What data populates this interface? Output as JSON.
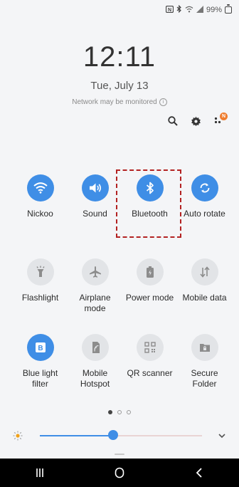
{
  "status_bar": {
    "nfc_icon": "nfc-icon",
    "bluetooth_icon": "bluetooth-icon",
    "wifi_icon": "wifi-icon",
    "signal_icon": "signal-icon",
    "battery_text": "99%"
  },
  "lock": {
    "time": "12:11",
    "date": "Tue, July 13",
    "network_notice": "Network may be monitored"
  },
  "actions": {
    "search_icon": "search-icon",
    "settings_icon": "gear-icon",
    "notification_badge": "N"
  },
  "tiles": [
    {
      "label": "Nickoo",
      "icon": "wifi-icon",
      "state": "on"
    },
    {
      "label": "Sound",
      "icon": "speaker-icon",
      "state": "on"
    },
    {
      "label": "Bluetooth",
      "icon": "bluetooth-icon",
      "state": "on"
    },
    {
      "label": "Auto rotate",
      "icon": "rotate-icon",
      "state": "on"
    },
    {
      "label": "Flashlight",
      "icon": "flashlight-icon",
      "state": "off"
    },
    {
      "label": "Airplane mode",
      "icon": "airplane-icon",
      "state": "off"
    },
    {
      "label": "Power mode",
      "icon": "battery-icon",
      "state": "off"
    },
    {
      "label": "Mobile data",
      "icon": "data-arrows-icon",
      "state": "off"
    },
    {
      "label": "Blue light filter",
      "icon": "bluelight-icon",
      "state": "on"
    },
    {
      "label": "Mobile Hotspot",
      "icon": "hotspot-icon",
      "state": "off"
    },
    {
      "label": "QR scanner",
      "icon": "qr-icon",
      "state": "off"
    },
    {
      "label": "Secure Folder",
      "icon": "secure-folder-icon",
      "state": "off"
    }
  ],
  "pager": {
    "count": 3,
    "active": 0
  },
  "brightness": {
    "level": 0.45
  },
  "colors": {
    "accent": "#3f8ee6",
    "highlight_box": "#b32222",
    "badge": "#ef7d2f"
  },
  "navbar": {
    "recents_icon": "recents-icon",
    "home_icon": "home-icon",
    "back_icon": "back-icon"
  }
}
